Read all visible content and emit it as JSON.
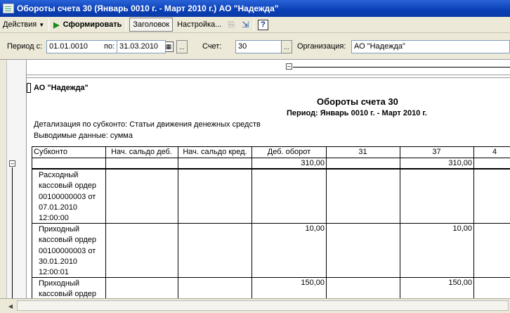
{
  "window": {
    "title": "Обороты счета 30 (Январь 0010 г. - Март 2010 г.) АО \"Надежда\""
  },
  "toolbar": {
    "actions_label": "Действия",
    "form_label": "Сформировать",
    "header_label": "Заголовок",
    "settings_label": "Настройка...",
    "help_label": "?"
  },
  "filters": {
    "period_from_label": "Период с:",
    "period_from_value": "01.01.0010",
    "period_to_label": "по:",
    "period_to_value": "31.03.2010",
    "account_label": "Счет:",
    "account_value": "30",
    "org_label": "Организация:",
    "org_value": "АО \"Надежда\"",
    "more_btn": "..."
  },
  "report": {
    "org": "АО \"Надежда\"",
    "title": "Обороты счета 30",
    "period": "Период: Январь 0010 г. - Март 2010 г.",
    "detail": "Детализация по субконто: Статьи движения денежных средств",
    "output": "Выводимые данные: сумма",
    "columns": [
      "Субконто",
      "Нач. сальдо деб.",
      "Нач. сальдо кред.",
      "Деб. оборот",
      "31",
      "37",
      "4"
    ],
    "rows": [
      {
        "subkonto": "",
        "deb_turnover": "310,00",
        "c31": "",
        "c37": "310,00"
      },
      {
        "subkonto": "Расходный кассовый ордер 00100000003 от 07.01.2010 12:00:00",
        "deb_turnover": "",
        "c31": "",
        "c37": ""
      },
      {
        "subkonto": "Приходный кассовый ордер 00100000003 от 30.01.2010 12:00:01",
        "deb_turnover": "10,00",
        "c31": "",
        "c37": "10,00"
      },
      {
        "subkonto": "Приходный кассовый ордер",
        "deb_turnover": "150,00",
        "c31": "",
        "c37": "150,00"
      }
    ]
  }
}
